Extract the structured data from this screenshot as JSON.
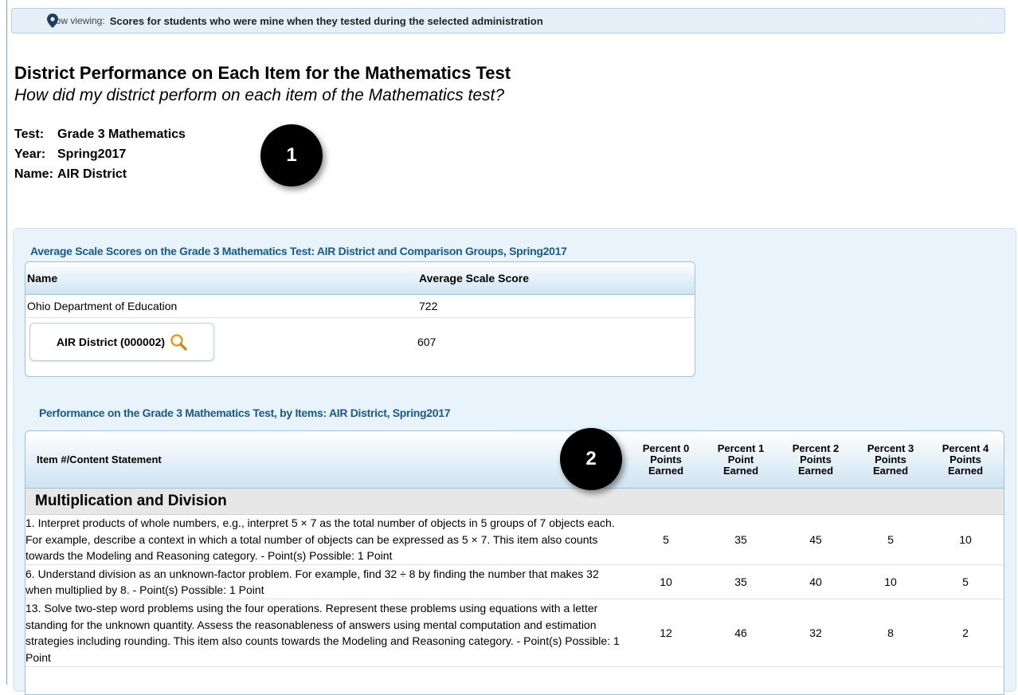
{
  "now_viewing": {
    "label": "Now viewing:",
    "value": "Scores for students who were mine when they tested during the selected administration"
  },
  "title": "District Performance on Each Item for the Mathematics Test",
  "subtitle": "How did my district perform on each item of the Mathematics test?",
  "meta": [
    {
      "key": "Test:",
      "value": "Grade 3 Mathematics"
    },
    {
      "key": "Year:",
      "value": "Spring2017"
    },
    {
      "key": "Name:",
      "value": "AIR District"
    }
  ],
  "callouts": [
    "1",
    "2"
  ],
  "scale_scores": {
    "title": "Average Scale Scores on the Grade 3 Mathematics Test: AIR District and Comparison Groups, Spring2017",
    "columns": [
      "Name",
      "Average Scale Score"
    ],
    "rows": [
      {
        "name": "Ohio Department of Education",
        "score": "722"
      },
      {
        "name": "AIR District (000002)",
        "score": "607"
      }
    ]
  },
  "items_table": {
    "title": "Performance on the Grade 3 Mathematics Test, by Items: AIR District, Spring2017",
    "item_col": "Item #/Content Statement",
    "pct_cols": [
      [
        "Percent 0",
        "Points",
        "Earned"
      ],
      [
        "Percent 1",
        "Point",
        "Earned"
      ],
      [
        "Percent 2",
        "Points",
        "Earned"
      ],
      [
        "Percent 3",
        "Points",
        "Earned"
      ],
      [
        "Percent 4",
        "Points",
        "Earned"
      ]
    ],
    "group": "Multiplication and Division",
    "rows": [
      {
        "text": "1. Interpret products of whole numbers, e.g., interpret 5 × 7 as the total number of objects in 5 groups of 7 objects each. For example, describe a context in which a total number of objects can be expressed as 5 × 7. This item also counts towards the Modeling and Reasoning category. - Point(s) Possible: 1 Point",
        "values": [
          "5",
          "35",
          "45",
          "5",
          "10"
        ]
      },
      {
        "text": "6. Understand division as an unknown-factor problem. For example, find 32 ÷ 8 by finding the number that makes 32 when multiplied by 8. - Point(s) Possible: 1 Point",
        "values": [
          "10",
          "35",
          "40",
          "10",
          "5"
        ]
      },
      {
        "text": "13. Solve two-step word problems using the four operations. Represent these problems using equations with a letter standing for the unknown quantity. Assess the reasonableness of answers using mental computation and estimation strategies including rounding. This item also counts towards the Modeling and Reasoning category. - Point(s) Possible: 1 Point",
        "values": [
          "12",
          "46",
          "32",
          "8",
          "2"
        ]
      }
    ]
  },
  "colors": {
    "accent_title": "#1b5a86",
    "panel_bg": "#e8f3fb",
    "group_bg": "#e7e7e7",
    "search_icon": "#e0a030"
  },
  "icons": [
    "location-pin-icon",
    "search-magnifier-icon"
  ]
}
